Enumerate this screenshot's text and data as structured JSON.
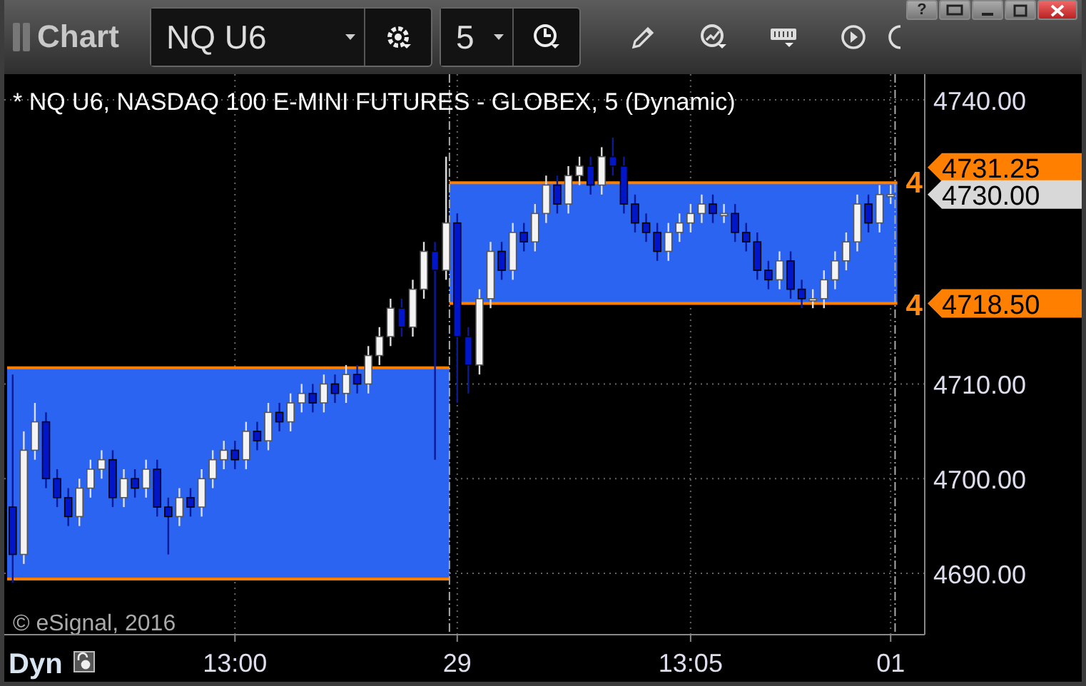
{
  "window": {
    "title": "Chart",
    "help_button": "?"
  },
  "toolbar": {
    "symbol": "NQ U6",
    "interval": "5"
  },
  "chart": {
    "header": "* NQ U6, NASDAQ 100 E-MINI FUTURES - GLOBEX, 5 (Dynamic)",
    "copyright": "© eSignal, 2016",
    "scale_mode": "Dyn",
    "chart_data": {
      "type": "candlestick",
      "ylim": [
        4683.53,
        4742.71
      ],
      "grid": true,
      "bands": [
        {
          "axis": "y",
          "from": 4689.4,
          "to": 4711.7,
          "color": "#2a64f0"
        },
        {
          "axis": "y",
          "from": 4718.5,
          "to": 4731.25,
          "color": "#2a64f0"
        }
      ],
      "ref_lines": [
        {
          "axis": "y",
          "value": 4711.7,
          "color": "#ff8000"
        },
        {
          "axis": "y",
          "value": 4689.4,
          "color": "#ff8000"
        },
        {
          "axis": "y",
          "value": 4731.25,
          "color": "#ff8000"
        },
        {
          "axis": "y",
          "value": 4718.5,
          "color": "#ff8000"
        }
      ],
      "yticks": [
        {
          "value": 4690,
          "label": "4690.00"
        },
        {
          "value": 4700,
          "label": "4700.00"
        },
        {
          "value": 4710,
          "label": "4710.00"
        },
        {
          "value": 4740,
          "label": "4740.00"
        }
      ],
      "categories": [
        null,
        null,
        null,
        null,
        null,
        null,
        null,
        null,
        null,
        null,
        null,
        null,
        null,
        null,
        null,
        null,
        null,
        null,
        null,
        null,
        "13:00",
        null,
        null,
        null,
        null,
        null,
        null,
        null,
        null,
        null,
        null,
        null,
        null,
        null,
        null,
        null,
        null,
        null,
        null,
        null,
        "29",
        null,
        null,
        null,
        null,
        null,
        null,
        null,
        null,
        null,
        null,
        null,
        null,
        null,
        null,
        null,
        null,
        null,
        null,
        null,
        null,
        "13:05",
        null,
        null,
        null,
        null,
        null,
        null,
        null,
        null,
        null,
        null,
        null,
        null,
        null,
        null,
        null,
        null,
        null,
        "01"
      ],
      "ohlc": [
        [
          4697,
          4711,
          4689,
          4692
        ],
        [
          4692,
          4705,
          4691,
          4703
        ],
        [
          4703,
          4708,
          4702,
          4706
        ],
        [
          4706,
          4707,
          4699,
          4700
        ],
        [
          4700,
          4701,
          4697,
          4698
        ],
        [
          4698,
          4699,
          4695,
          4696
        ],
        [
          4696,
          4700,
          4695,
          4699
        ],
        [
          4699,
          4702,
          4698,
          4701
        ],
        [
          4701,
          4703,
          4700,
          4702
        ],
        [
          4702,
          4703,
          4697,
          4698
        ],
        [
          4698,
          4701,
          4697,
          4700
        ],
        [
          4700,
          4701,
          4698,
          4699
        ],
        [
          4699,
          4702,
          4698,
          4701
        ],
        [
          4701,
          4702,
          4696,
          4697
        ],
        [
          4697,
          4698,
          4692,
          4696
        ],
        [
          4696,
          4699,
          4695,
          4698
        ],
        [
          4698,
          4699,
          4696,
          4697
        ],
        [
          4697,
          4701,
          4696,
          4700
        ],
        [
          4700,
          4703,
          4699,
          4702
        ],
        [
          4702,
          4704,
          4701,
          4703
        ],
        [
          4703,
          4704,
          4701,
          4702
        ],
        [
          4702,
          4706,
          4701,
          4705
        ],
        [
          4705,
          4706,
          4703,
          4704
        ],
        [
          4704,
          4708,
          4703,
          4707
        ],
        [
          4707,
          4708,
          4705,
          4706
        ],
        [
          4706,
          4709,
          4705,
          4708
        ],
        [
          4708,
          4710,
          4707,
          4709
        ],
        [
          4709,
          4710,
          4707,
          4708
        ],
        [
          4708,
          4711,
          4707,
          4710
        ],
        [
          4710,
          4711,
          4708,
          4709
        ],
        [
          4709,
          4712,
          4708,
          4711
        ],
        [
          4711,
          4712,
          4709,
          4710
        ],
        [
          4710,
          4714,
          4709,
          4713
        ],
        [
          4713,
          4716,
          4712,
          4715
        ],
        [
          4715,
          4719,
          4714,
          4718
        ],
        [
          4718,
          4719,
          4715,
          4716
        ],
        [
          4716,
          4721,
          4715,
          4720
        ],
        [
          4720,
          4725,
          4719,
          4724
        ],
        [
          4724,
          4725,
          4702,
          4722
        ],
        [
          4722,
          4734,
          4721,
          4727
        ],
        [
          4727,
          4728,
          4708,
          4715
        ],
        [
          4715,
          4716,
          4709,
          4712
        ],
        [
          4712,
          4720,
          4711,
          4719
        ],
        [
          4719,
          4725,
          4718,
          4724
        ],
        [
          4724,
          4725,
          4721,
          4722
        ],
        [
          4722,
          4727,
          4721,
          4726
        ],
        [
          4726,
          4727,
          4724,
          4725
        ],
        [
          4725,
          4729,
          4724,
          4728
        ],
        [
          4728,
          4732,
          4727,
          4731
        ],
        [
          4731,
          4732,
          4728,
          4729
        ],
        [
          4729,
          4733,
          4728,
          4732
        ],
        [
          4732,
          4734,
          4731,
          4733
        ],
        [
          4733,
          4734,
          4730,
          4731
        ],
        [
          4731,
          4735,
          4730,
          4734
        ],
        [
          4734,
          4736,
          4732,
          4733
        ],
        [
          4733,
          4734,
          4728,
          4729
        ],
        [
          4729,
          4730,
          4726,
          4727
        ],
        [
          4727,
          4728,
          4725,
          4726
        ],
        [
          4726,
          4727,
          4723,
          4724
        ],
        [
          4724,
          4727,
          4723,
          4726
        ],
        [
          4726,
          4728,
          4725,
          4727
        ],
        [
          4727,
          4729,
          4726,
          4728
        ],
        [
          4728,
          4730,
          4727,
          4729
        ],
        [
          4729,
          4730,
          4727,
          4728
        ],
        [
          4728,
          4729,
          4727,
          4728
        ],
        [
          4728,
          4729,
          4725,
          4726
        ],
        [
          4726,
          4727,
          4724,
          4725
        ],
        [
          4725,
          4726,
          4721,
          4722
        ],
        [
          4722,
          4723,
          4720,
          4721
        ],
        [
          4721,
          4724,
          4720,
          4723
        ],
        [
          4723,
          4724,
          4719,
          4720
        ],
        [
          4720,
          4721,
          4718,
          4719
        ],
        [
          4719,
          4720,
          4718,
          4719
        ],
        [
          4719,
          4722,
          4718,
          4721
        ],
        [
          4721,
          4724,
          4720,
          4723
        ],
        [
          4723,
          4726,
          4722,
          4725
        ],
        [
          4725,
          4730,
          4724,
          4729
        ],
        [
          4729,
          4730,
          4726,
          4727
        ],
        [
          4727,
          4731,
          4726,
          4730
        ],
        [
          4730,
          4731,
          4729,
          4730
        ]
      ]
    },
    "box_labels": [
      "4",
      "4"
    ],
    "price_tags": [
      {
        "label": "4731.25",
        "color": "#ff8000"
      },
      {
        "label": "4730.00",
        "color": "#d8d8d8"
      },
      {
        "label": "4718.50",
        "color": "#ff8000"
      }
    ]
  }
}
